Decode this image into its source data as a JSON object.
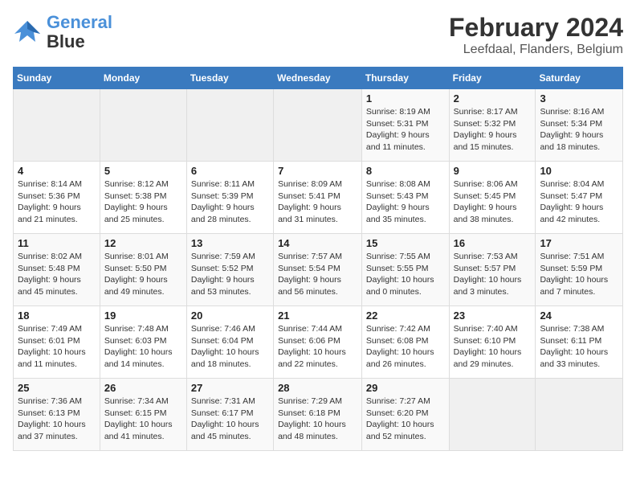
{
  "header": {
    "logo_line1": "General",
    "logo_line2": "Blue",
    "title": "February 2024",
    "subtitle": "Leefdaal, Flanders, Belgium"
  },
  "days_of_week": [
    "Sunday",
    "Monday",
    "Tuesday",
    "Wednesday",
    "Thursday",
    "Friday",
    "Saturday"
  ],
  "weeks": [
    [
      {
        "day": "",
        "info": ""
      },
      {
        "day": "",
        "info": ""
      },
      {
        "day": "",
        "info": ""
      },
      {
        "day": "",
        "info": ""
      },
      {
        "day": "1",
        "info": "Sunrise: 8:19 AM\nSunset: 5:31 PM\nDaylight: 9 hours\nand 11 minutes."
      },
      {
        "day": "2",
        "info": "Sunrise: 8:17 AM\nSunset: 5:32 PM\nDaylight: 9 hours\nand 15 minutes."
      },
      {
        "day": "3",
        "info": "Sunrise: 8:16 AM\nSunset: 5:34 PM\nDaylight: 9 hours\nand 18 minutes."
      }
    ],
    [
      {
        "day": "4",
        "info": "Sunrise: 8:14 AM\nSunset: 5:36 PM\nDaylight: 9 hours\nand 21 minutes."
      },
      {
        "day": "5",
        "info": "Sunrise: 8:12 AM\nSunset: 5:38 PM\nDaylight: 9 hours\nand 25 minutes."
      },
      {
        "day": "6",
        "info": "Sunrise: 8:11 AM\nSunset: 5:39 PM\nDaylight: 9 hours\nand 28 minutes."
      },
      {
        "day": "7",
        "info": "Sunrise: 8:09 AM\nSunset: 5:41 PM\nDaylight: 9 hours\nand 31 minutes."
      },
      {
        "day": "8",
        "info": "Sunrise: 8:08 AM\nSunset: 5:43 PM\nDaylight: 9 hours\nand 35 minutes."
      },
      {
        "day": "9",
        "info": "Sunrise: 8:06 AM\nSunset: 5:45 PM\nDaylight: 9 hours\nand 38 minutes."
      },
      {
        "day": "10",
        "info": "Sunrise: 8:04 AM\nSunset: 5:47 PM\nDaylight: 9 hours\nand 42 minutes."
      }
    ],
    [
      {
        "day": "11",
        "info": "Sunrise: 8:02 AM\nSunset: 5:48 PM\nDaylight: 9 hours\nand 45 minutes."
      },
      {
        "day": "12",
        "info": "Sunrise: 8:01 AM\nSunset: 5:50 PM\nDaylight: 9 hours\nand 49 minutes."
      },
      {
        "day": "13",
        "info": "Sunrise: 7:59 AM\nSunset: 5:52 PM\nDaylight: 9 hours\nand 53 minutes."
      },
      {
        "day": "14",
        "info": "Sunrise: 7:57 AM\nSunset: 5:54 PM\nDaylight: 9 hours\nand 56 minutes."
      },
      {
        "day": "15",
        "info": "Sunrise: 7:55 AM\nSunset: 5:55 PM\nDaylight: 10 hours\nand 0 minutes."
      },
      {
        "day": "16",
        "info": "Sunrise: 7:53 AM\nSunset: 5:57 PM\nDaylight: 10 hours\nand 3 minutes."
      },
      {
        "day": "17",
        "info": "Sunrise: 7:51 AM\nSunset: 5:59 PM\nDaylight: 10 hours\nand 7 minutes."
      }
    ],
    [
      {
        "day": "18",
        "info": "Sunrise: 7:49 AM\nSunset: 6:01 PM\nDaylight: 10 hours\nand 11 minutes."
      },
      {
        "day": "19",
        "info": "Sunrise: 7:48 AM\nSunset: 6:03 PM\nDaylight: 10 hours\nand 14 minutes."
      },
      {
        "day": "20",
        "info": "Sunrise: 7:46 AM\nSunset: 6:04 PM\nDaylight: 10 hours\nand 18 minutes."
      },
      {
        "day": "21",
        "info": "Sunrise: 7:44 AM\nSunset: 6:06 PM\nDaylight: 10 hours\nand 22 minutes."
      },
      {
        "day": "22",
        "info": "Sunrise: 7:42 AM\nSunset: 6:08 PM\nDaylight: 10 hours\nand 26 minutes."
      },
      {
        "day": "23",
        "info": "Sunrise: 7:40 AM\nSunset: 6:10 PM\nDaylight: 10 hours\nand 29 minutes."
      },
      {
        "day": "24",
        "info": "Sunrise: 7:38 AM\nSunset: 6:11 PM\nDaylight: 10 hours\nand 33 minutes."
      }
    ],
    [
      {
        "day": "25",
        "info": "Sunrise: 7:36 AM\nSunset: 6:13 PM\nDaylight: 10 hours\nand 37 minutes."
      },
      {
        "day": "26",
        "info": "Sunrise: 7:34 AM\nSunset: 6:15 PM\nDaylight: 10 hours\nand 41 minutes."
      },
      {
        "day": "27",
        "info": "Sunrise: 7:31 AM\nSunset: 6:17 PM\nDaylight: 10 hours\nand 45 minutes."
      },
      {
        "day": "28",
        "info": "Sunrise: 7:29 AM\nSunset: 6:18 PM\nDaylight: 10 hours\nand 48 minutes."
      },
      {
        "day": "29",
        "info": "Sunrise: 7:27 AM\nSunset: 6:20 PM\nDaylight: 10 hours\nand 52 minutes."
      },
      {
        "day": "",
        "info": ""
      },
      {
        "day": "",
        "info": ""
      }
    ]
  ]
}
